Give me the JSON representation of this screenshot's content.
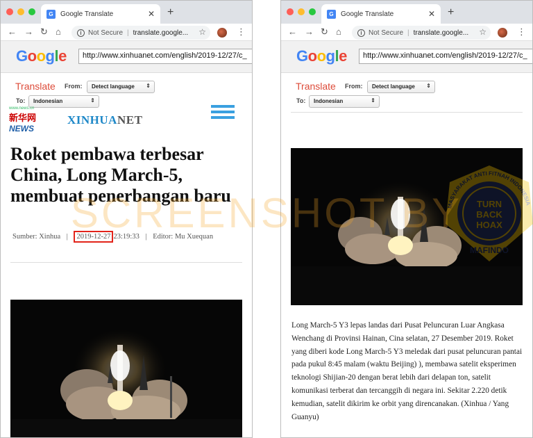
{
  "left_window": {
    "tab_title": "Google Translate",
    "omnibox": {
      "security": "Not Secure",
      "url": "translate.google..."
    },
    "google_url": "http://www.xinhuanet.com/english/2019-12/27/c_",
    "translate": {
      "title": "Translate",
      "from_label": "From:",
      "from_value": "Detect language",
      "to_label": "To:",
      "to_value": "Indonesian"
    },
    "site": {
      "logo_small": "www.news.cn",
      "logo_cn": "新华网",
      "logo_news": "NEWS",
      "brand_main": "XINHUA",
      "brand_suffix": "NET"
    },
    "article": {
      "headline": "Roket pembawa terbesar China, Long March-5, membuat penerbangan baru",
      "source": "Sumber: Xinhua",
      "date": "2019-12-27",
      "time": "23:19:33",
      "editor": "Editor: Mu Xuequan"
    }
  },
  "right_window": {
    "tab_title": "Google Translate",
    "omnibox": {
      "security": "Not Secure",
      "url": "translate.google..."
    },
    "google_url": "http://www.xinhuanet.com/english/2019-12/27/c_",
    "translate": {
      "title": "Translate",
      "from_label": "From:",
      "from_value": "Detect language",
      "to_label": "To:",
      "to_value": "Indonesian"
    },
    "article": {
      "body": "Long March-5 Y3 lepas landas dari Pusat Peluncuran Luar Angkasa Wenchang di Provinsi Hainan, Cina selatan, 27 Desember 2019. Roket yang diberi kode Long March-5 Y3 meledak dari pusat peluncuran pantai pada pukul 8:45 malam (waktu Beijing) ), membawa satelit eksperimen teknologi Shijian-20 dengan berat lebih dari delapan ton, satelit komunikasi terberat dan tercanggih di negara ini. Sekitar 2.220 detik kemudian, satelit dikirim ke orbit yang direncanakan. (Xinhua / Yang Guanyu)"
    }
  },
  "watermark": {
    "text": "SCREENSHOT BY",
    "badge_ring": "MASYARAKAT ANTI FITNAH INDONESIA",
    "badge_center_1": "TURN",
    "badge_center_2": "BACK",
    "badge_center_3": "HOAX",
    "badge_bottom": "MAFINDO"
  },
  "colors": {
    "translate_red": "#dd4b39",
    "highlight_box": "#e2231a",
    "xinhua_blue": "#1e88c8",
    "hamburger_blue": "#3aa0e0",
    "watermark_orange": "#f5a528",
    "mafindo_navy": "#1f2f6e",
    "mafindo_yellow": "#f2c200"
  }
}
